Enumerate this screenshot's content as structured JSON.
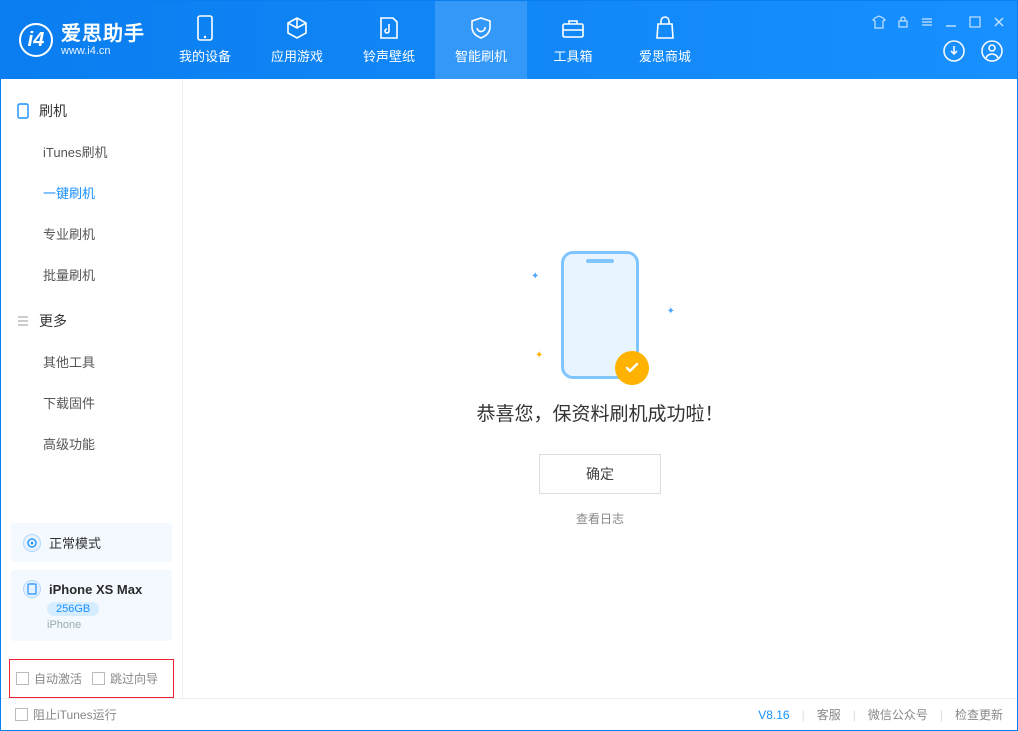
{
  "app": {
    "name": "爱思助手",
    "url": "www.i4.cn"
  },
  "nav": [
    {
      "label": "我的设备"
    },
    {
      "label": "应用游戏"
    },
    {
      "label": "铃声壁纸"
    },
    {
      "label": "智能刷机",
      "active": true
    },
    {
      "label": "工具箱"
    },
    {
      "label": "爱思商城"
    }
  ],
  "sidebar": {
    "sections": [
      {
        "title": "刷机",
        "items": [
          "iTunes刷机",
          "一键刷机",
          "专业刷机",
          "批量刷机"
        ],
        "activeIndex": 1
      },
      {
        "title": "更多",
        "items": [
          "其他工具",
          "下载固件",
          "高级功能"
        ]
      }
    ],
    "mode": "正常模式",
    "device": {
      "name": "iPhone XS Max",
      "storage": "256GB",
      "type": "iPhone"
    },
    "checkboxes": [
      "自动激活",
      "跳过向导"
    ]
  },
  "main": {
    "success_text": "恭喜您，保资料刷机成功啦！",
    "ok": "确定",
    "view_log": "查看日志"
  },
  "footer": {
    "block_itunes": "阻止iTunes运行",
    "version": "V8.16",
    "links": [
      "客服",
      "微信公众号",
      "检查更新"
    ]
  }
}
